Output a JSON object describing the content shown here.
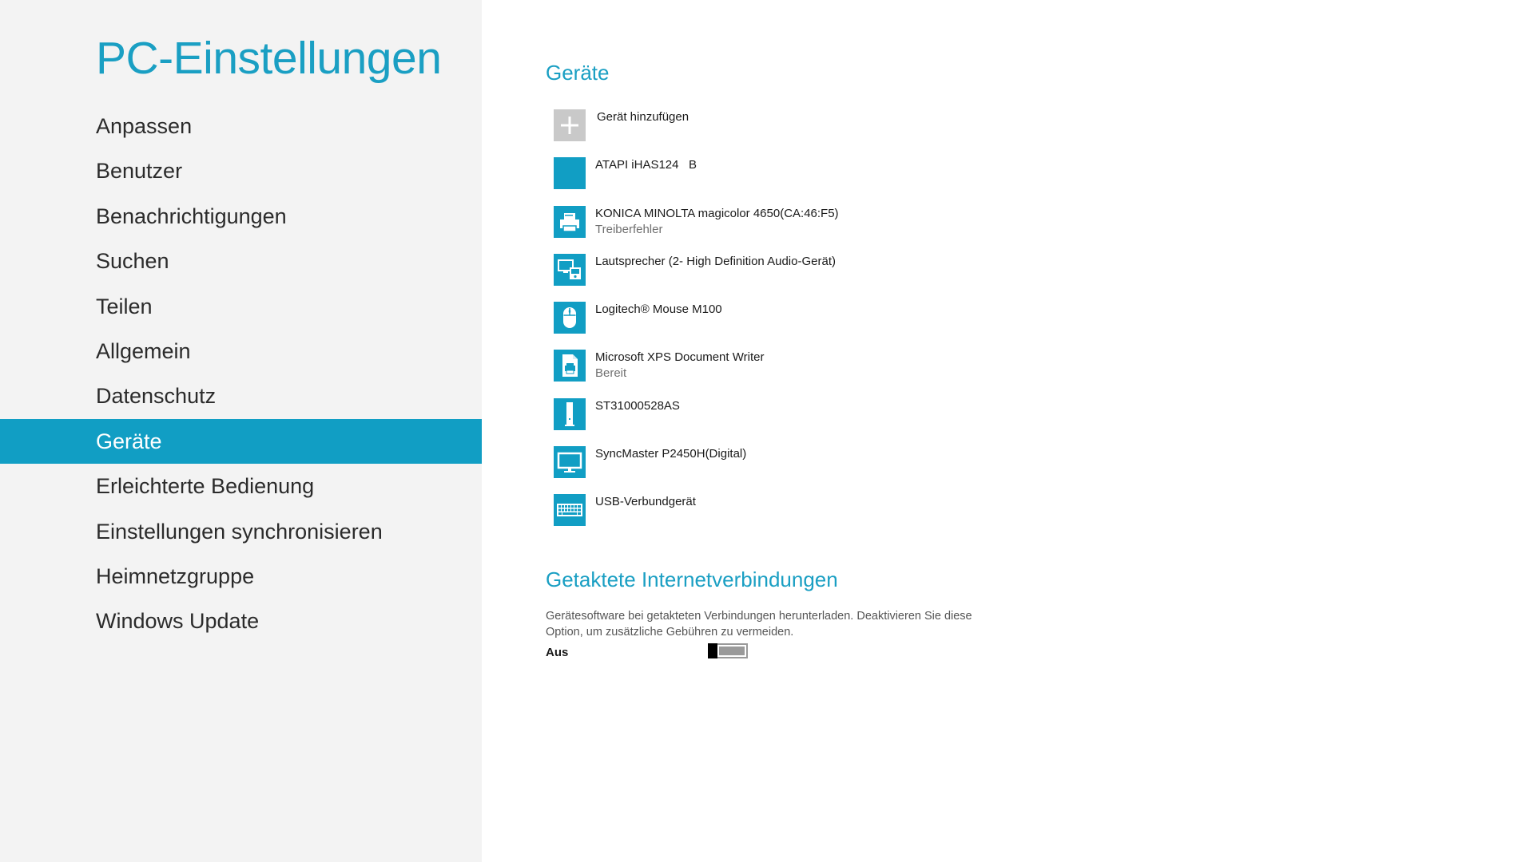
{
  "app": {
    "title": "PC-Einstellungen"
  },
  "nav": {
    "items": [
      {
        "label": "Anpassen"
      },
      {
        "label": "Benutzer"
      },
      {
        "label": "Benachrichtigungen"
      },
      {
        "label": "Suchen"
      },
      {
        "label": "Teilen"
      },
      {
        "label": "Allgemein"
      },
      {
        "label": "Datenschutz"
      },
      {
        "label": "Geräte",
        "selected": true
      },
      {
        "label": "Erleichterte Bedienung"
      },
      {
        "label": "Einstellungen synchronisieren"
      },
      {
        "label": "Heimnetzgruppe"
      },
      {
        "label": "Windows Update"
      }
    ]
  },
  "devices": {
    "title": "Geräte",
    "add_label": "Gerät hinzufügen",
    "items": [
      {
        "name": "ATAPI iHAS124   B",
        "status": "",
        "icon": "optical-drive-icon"
      },
      {
        "name": "KONICA MINOLTA magicolor 4650(CA:46:F5)",
        "status": "Treiberfehler",
        "icon": "printer-icon"
      },
      {
        "name": "Lautsprecher (2- High Definition Audio-Gerät)",
        "status": "",
        "icon": "multimedia-device-icon"
      },
      {
        "name": "Logitech® Mouse M100",
        "status": "",
        "icon": "mouse-icon"
      },
      {
        "name": "Microsoft XPS Document Writer",
        "status": "Bereit",
        "icon": "document-printer-icon"
      },
      {
        "name": "ST31000528AS",
        "status": "",
        "icon": "hard-drive-icon"
      },
      {
        "name": "SyncMaster P2450H(Digital)",
        "status": "",
        "icon": "monitor-icon"
      },
      {
        "name": "USB-Verbundgerät",
        "status": "",
        "icon": "keyboard-icon"
      }
    ]
  },
  "metered": {
    "title": "Getaktete Internetverbindungen",
    "description": "Gerätesoftware bei getakteten Verbindungen herunterladen. Deaktivieren Sie diese Option, um zusätzliche Gebühren zu vermeiden.",
    "toggle_state": "Aus",
    "toggle_on": false
  },
  "colors": {
    "accent": "#119ec4",
    "title_accent": "#1a9fc3",
    "sidebar_bg": "#f3f3f3",
    "add_tile": "#c9c9c9"
  }
}
